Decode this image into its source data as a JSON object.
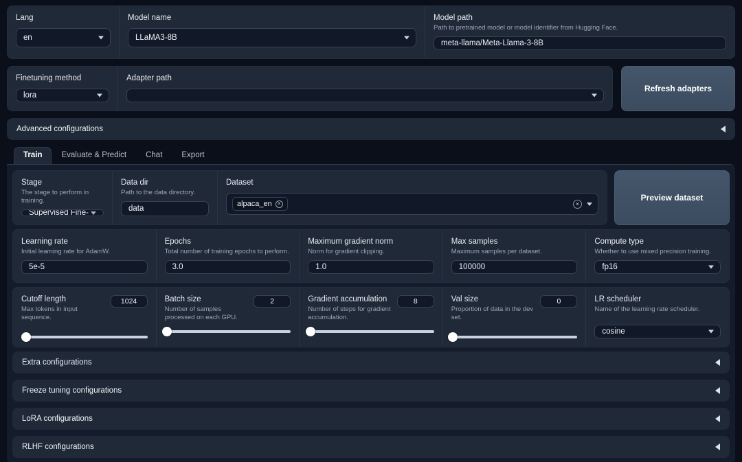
{
  "top_row": {
    "lang": {
      "label": "Lang",
      "value": "en"
    },
    "model_name": {
      "label": "Model name",
      "value": "LLaMA3-8B"
    },
    "model_path": {
      "label": "Model path",
      "hint": "Path to pretrained model or model identifier from Hugging Face.",
      "value": "meta-llama/Meta-Llama-3-8B"
    }
  },
  "second_row": {
    "finetuning_method": {
      "label": "Finetuning method",
      "value": "lora"
    },
    "adapter_path": {
      "label": "Adapter path",
      "value": ""
    },
    "refresh_button": "Refresh adapters"
  },
  "advanced_accordion": {
    "label": "Advanced configurations"
  },
  "tabs": [
    {
      "label": "Train",
      "active": true
    },
    {
      "label": "Evaluate & Predict",
      "active": false
    },
    {
      "label": "Chat",
      "active": false
    },
    {
      "label": "Export",
      "active": false
    }
  ],
  "train": {
    "stage": {
      "label": "Stage",
      "hint": "The stage to perform in training.",
      "value": "Supervised Fine-Tuning"
    },
    "data_dir": {
      "label": "Data dir",
      "hint": "Path to the data directory.",
      "value": "data"
    },
    "dataset": {
      "label": "Dataset",
      "chips": [
        "alpaca_en"
      ]
    },
    "preview_button": "Preview dataset",
    "numeric_fields": [
      {
        "label": "Learning rate",
        "hint": "Initial learning rate for AdamW.",
        "value": "5e-5",
        "type": "text"
      },
      {
        "label": "Epochs",
        "hint": "Total number of training epochs to perform.",
        "value": "3.0",
        "type": "text"
      },
      {
        "label": "Maximum gradient norm",
        "hint": "Norm for gradient clipping.",
        "value": "1.0",
        "type": "text"
      },
      {
        "label": "Max samples",
        "hint": "Maximum samples per dataset.",
        "value": "100000",
        "type": "text"
      },
      {
        "label": "Compute type",
        "hint": "Whether to use mixed precision training.",
        "value": "fp16",
        "type": "dropdown"
      }
    ],
    "sliders": [
      {
        "label": "Cutoff length",
        "hint": "Max tokens in input sequence.",
        "value": "1024",
        "percent": 4
      },
      {
        "label": "Batch size",
        "hint": "Number of samples processed on each GPU.",
        "value": "2",
        "percent": 2
      },
      {
        "label": "Gradient accumulation",
        "hint": "Number of steps for gradient accumulation.",
        "value": "8",
        "percent": 2
      },
      {
        "label": "Val size",
        "hint": "Proportion of data in the dev set.",
        "value": "0",
        "percent": 1
      }
    ],
    "lr_scheduler": {
      "label": "LR scheduler",
      "hint": "Name of the learning rate scheduler.",
      "value": "cosine"
    },
    "accordions": [
      {
        "label": "Extra configurations"
      },
      {
        "label": "Freeze tuning configurations"
      },
      {
        "label": "LoRA configurations"
      },
      {
        "label": "RLHF configurations"
      }
    ]
  },
  "colors": {
    "page_background": "#0b0f19",
    "panel_background": "#1f2937",
    "field_background": "#111827",
    "border": "#374151",
    "text_primary": "#e9edf3",
    "text_hint": "#9ca6b4",
    "button_background": "#44566b",
    "slider_track": "#c9d2de",
    "slider_tick": "#2563eb"
  }
}
